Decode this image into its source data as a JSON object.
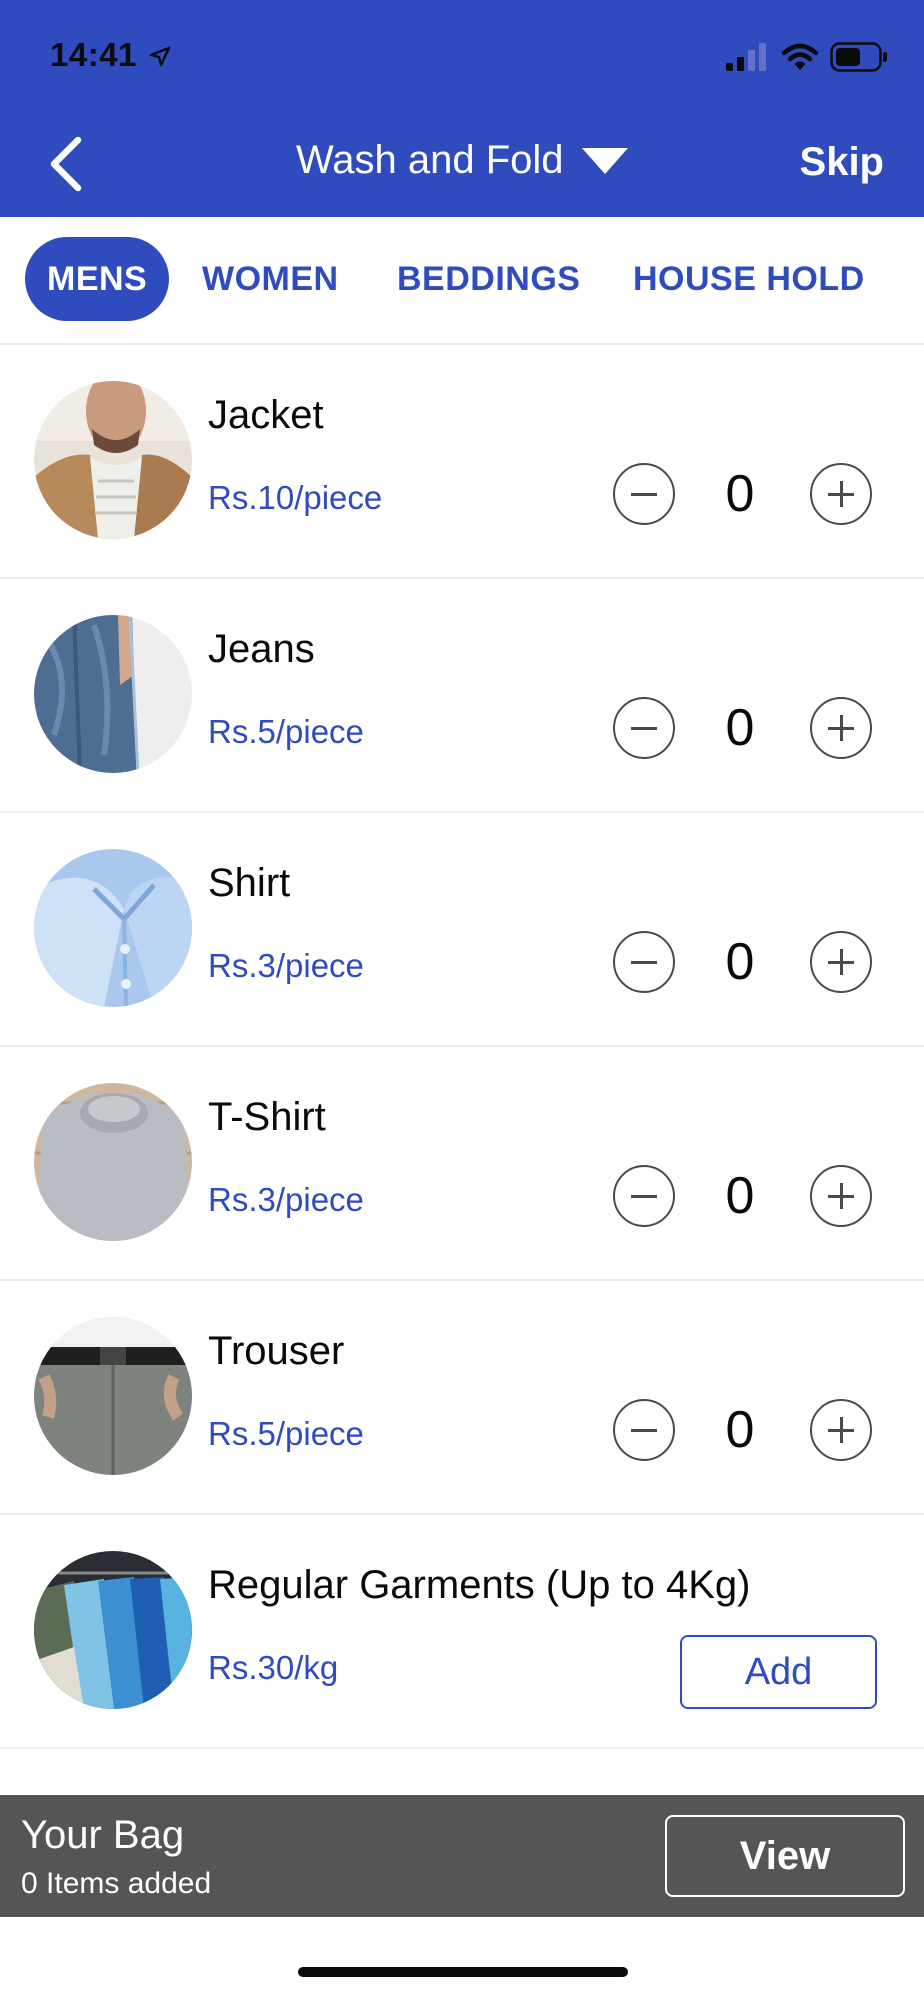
{
  "status_bar": {
    "time": "14:41",
    "icons": [
      "location-arrow-icon",
      "signal-icon",
      "wifi-icon",
      "battery-icon"
    ]
  },
  "header": {
    "title": "Wash and Fold",
    "skip_label": "Skip",
    "background_color": "#2f4bbe"
  },
  "tabs": [
    {
      "label": "MENS",
      "active": true
    },
    {
      "label": "WOMEN",
      "active": false
    },
    {
      "label": "BEDDINGS",
      "active": false
    },
    {
      "label": "HOUSE HOLD",
      "active": false
    }
  ],
  "items": [
    {
      "name": "Jacket",
      "price": "Rs.10/piece",
      "quantity": "0",
      "image": "jacket-photo"
    },
    {
      "name": "Jeans",
      "price": "Rs.5/piece",
      "quantity": "0",
      "image": "jeans-photo"
    },
    {
      "name": "Shirt",
      "price": "Rs.3/piece",
      "quantity": "0",
      "image": "shirt-photo"
    },
    {
      "name": "T-Shirt",
      "price": "Rs.3/piece",
      "quantity": "0",
      "image": "tshirt-photo"
    },
    {
      "name": "Trouser",
      "price": "Rs.5/piece",
      "quantity": "0",
      "image": "trouser-photo"
    },
    {
      "name": "Regular Garments (Up to 4Kg)",
      "price": "Rs.30/kg",
      "add_label": "Add",
      "image": "garments-rack-photo"
    }
  ],
  "bag": {
    "title": "Your Bag",
    "count_text": "0 Items added",
    "view_label": "View"
  },
  "colors": {
    "accent": "#2f4bbe",
    "bag_bar": "#555555"
  }
}
